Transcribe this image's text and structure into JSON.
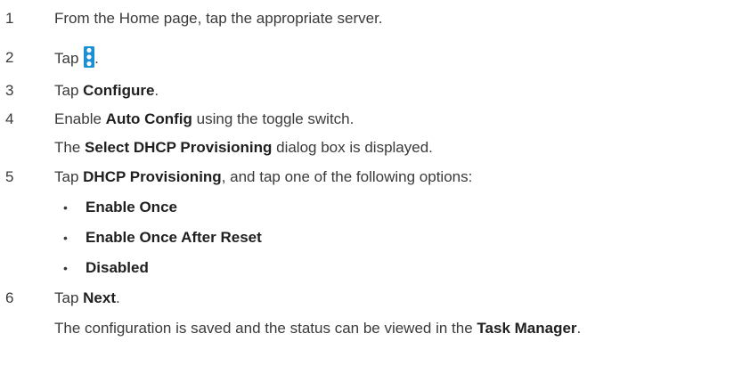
{
  "icons": {
    "more_options_icon": "kebab-menu-icon",
    "accent_color": "#1a8fd6"
  },
  "steps": [
    {
      "number": "1",
      "text": "From the Home page, tap the appropriate server."
    },
    {
      "number": "2",
      "prefix": "Tap ",
      "suffix": "."
    },
    {
      "number": "3",
      "prefix": "Tap ",
      "bold": "Configure",
      "suffix": "."
    },
    {
      "number": "4",
      "prefix": "Enable ",
      "bold": "Auto Config",
      "suffix": " using the toggle switch.",
      "result": {
        "prefix": "The ",
        "bold": "Select DHCP Provisioning",
        "suffix": " dialog box is displayed."
      }
    },
    {
      "number": "5",
      "prefix": "Tap ",
      "bold": "DHCP Provisioning",
      "suffix": ", and tap one of the following options:",
      "bullet": "•",
      "options": [
        "Enable Once",
        "Enable Once After Reset",
        "Disabled"
      ]
    },
    {
      "number": "6",
      "prefix": "Tap ",
      "bold": "Next",
      "suffix": ".",
      "result": {
        "prefix": "The configuration is saved and the status can be viewed in the ",
        "bold": "Task Manager",
        "suffix": "."
      }
    }
  ]
}
